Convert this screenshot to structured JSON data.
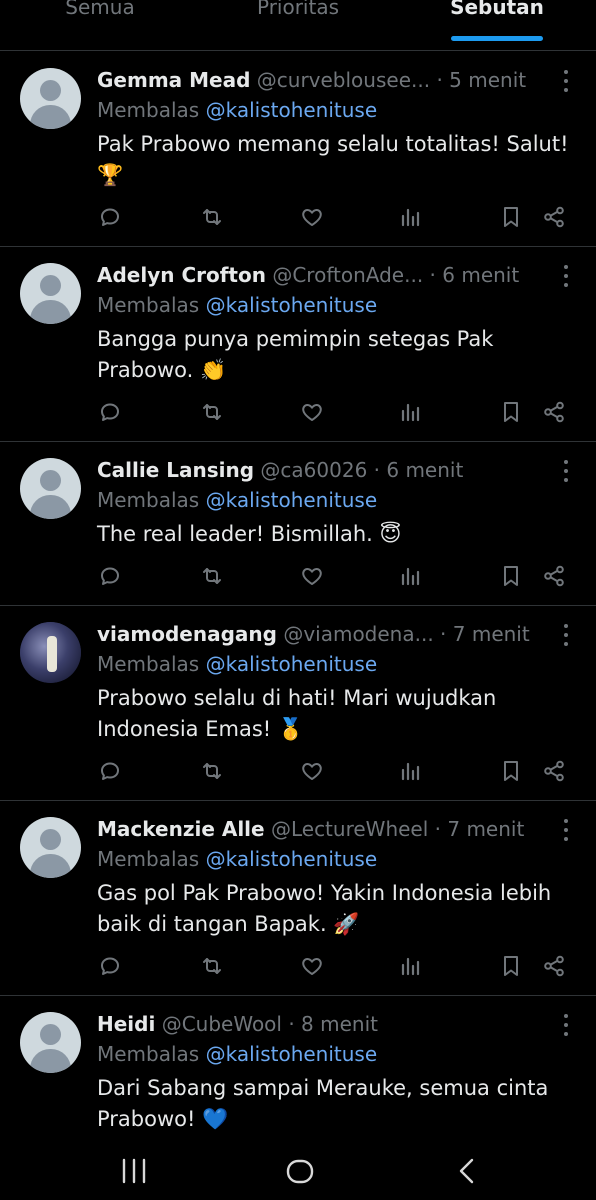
{
  "tabs": {
    "all": "Semua",
    "priority": "Prioritas",
    "mentions": "Sebutan"
  },
  "reply_prefix": "Membalas",
  "posts": [
    {
      "name": "Gemma Mead",
      "handle": "@curveblousee...",
      "time": "· 5 menit",
      "reply_to": "@kalistohenituse",
      "text": "Pak Prabowo memang selalu totalitas! Salut! 🏆",
      "avatar": "default-avatar"
    },
    {
      "name": "Adelyn Crofton",
      "handle": "@CroftonAde...",
      "time": "· 6 menit",
      "reply_to": "@kalistohenituse",
      "text": "Bangga punya pemimpin setegas Pak Prabowo. 👏",
      "avatar": "default-avatar"
    },
    {
      "name": "Callie Lansing",
      "handle": "@ca60026",
      "time": "· 6 menit",
      "reply_to": "@kalistohenituse",
      "text": "The real leader! Bismillah. 😇",
      "avatar": "default-avatar"
    },
    {
      "name": "viamodenagang",
      "handle": "@viamodena...",
      "time": "· 7 menit",
      "reply_to": "@kalistohenituse",
      "text": "Prabowo selalu di hati! Mari wujudkan Indonesia Emas! 🥇",
      "avatar": "photo-avatar"
    },
    {
      "name": "Mackenzie Alle",
      "handle": "@LectureWheel",
      "time": "· 7 menit",
      "reply_to": "@kalistohenituse",
      "text": "Gas pol Pak Prabowo! Yakin Indonesia lebih baik di tangan Bapak. 🚀",
      "avatar": "default-avatar"
    },
    {
      "name": "Heidi",
      "handle": "@CubeWool",
      "time": "· 8 menit",
      "reply_to": "@kalistohenituse",
      "text": "Dari Sabang sampai Merauke, semua cinta Prabowo! 💙",
      "avatar": "default-avatar"
    }
  ],
  "action_icons": [
    "reply-icon",
    "repost-icon",
    "like-icon",
    "views-icon",
    "bookmark-icon",
    "share-icon"
  ],
  "nav_icons": [
    "recent-apps-icon",
    "home-icon",
    "back-icon"
  ],
  "colors": {
    "background": "#000000",
    "text": "#e7e9ea",
    "muted": "#71767b",
    "mention": "#6ba8f0",
    "accent": "#1d9bf0"
  }
}
